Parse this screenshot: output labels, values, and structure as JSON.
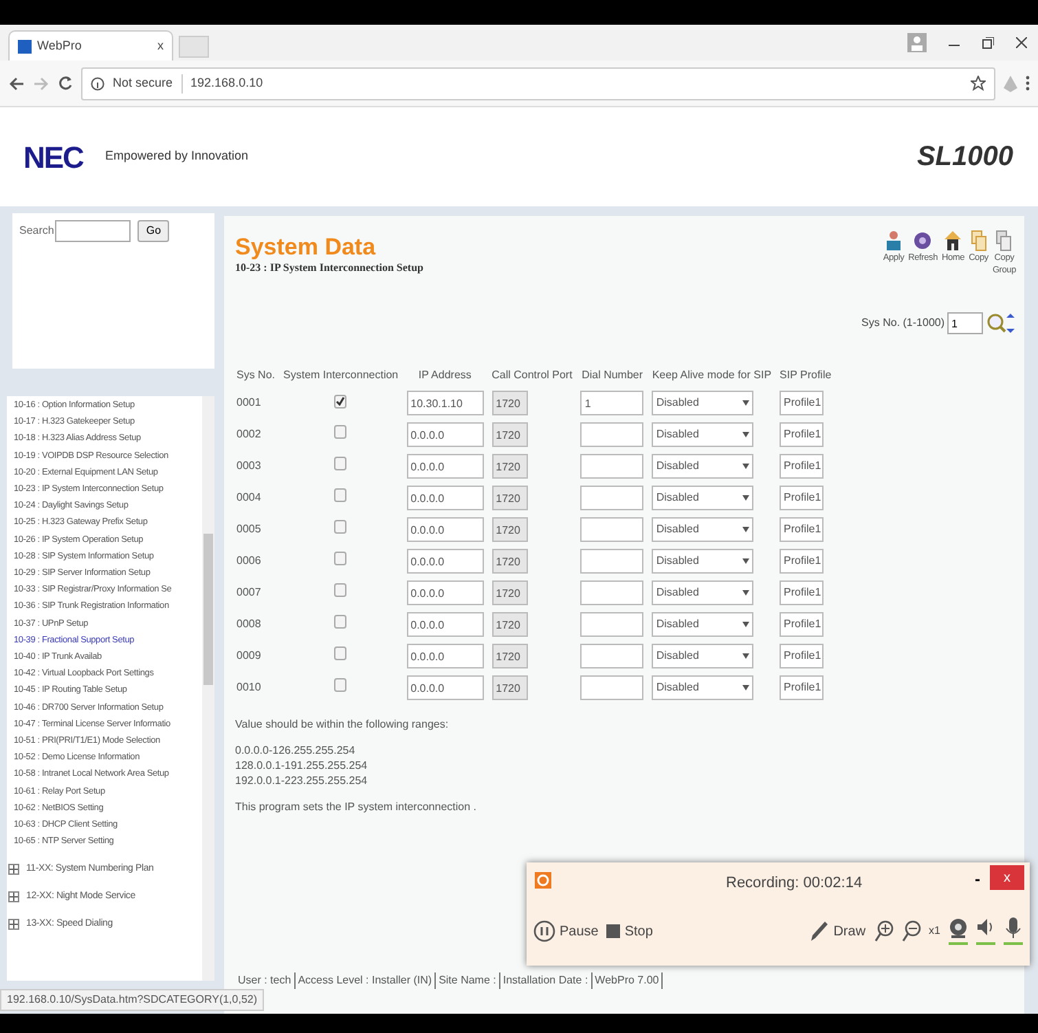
{
  "browser": {
    "tab_title": "WebPro",
    "tab_close": "x",
    "security": "Not secure",
    "url": "192.168.0.10"
  },
  "header": {
    "logo": "NEC",
    "tagline": "Empowered by Innovation",
    "model": "SL1000"
  },
  "search": {
    "label": "Search",
    "button": "Go"
  },
  "tree": {
    "items": [
      {
        "label": "10-16 : Option Information Setup",
        "selected": false
      },
      {
        "label": "10-17 : H.323 Gatekeeper Setup",
        "selected": false
      },
      {
        "label": "10-18 : H.323 Alias Address Setup",
        "selected": false
      },
      {
        "label": "10-19 : VOIPDB DSP Resource Selection",
        "selected": false
      },
      {
        "label": "10-20 : External Equipment LAN Setup",
        "selected": false
      },
      {
        "label": "10-23 : IP System Interconnection Setup",
        "selected": false
      },
      {
        "label": "10-24 : Daylight Savings Setup",
        "selected": false
      },
      {
        "label": "10-25 : H.323 Gateway Prefix Setup",
        "selected": false
      },
      {
        "label": "10-26 : IP System Operation Setup",
        "selected": false
      },
      {
        "label": "10-28 : SIP System Information Setup",
        "selected": false
      },
      {
        "label": "10-29 : SIP Server Information Setup",
        "selected": false
      },
      {
        "label": "10-33 : SIP Registrar/Proxy Information Se",
        "selected": false
      },
      {
        "label": "10-36 : SIP Trunk Registration Information",
        "selected": false
      },
      {
        "label": "10-37 : UPnP Setup",
        "selected": false
      },
      {
        "label": "10-39 : Fractional Support Setup",
        "selected": true
      },
      {
        "label": "10-40 : IP Trunk Availab",
        "selected": false
      },
      {
        "label": "10-42 : Virtual Loopback Port Settings",
        "selected": false
      },
      {
        "label": "10-45 : IP Routing Table Setup",
        "selected": false
      },
      {
        "label": "10-46 : DR700 Server Information Setup",
        "selected": false
      },
      {
        "label": "10-47 : Terminal License Server Informatio",
        "selected": false
      },
      {
        "label": "10-51 : PRI(PRI/T1/E1) Mode Selection",
        "selected": false
      },
      {
        "label": "10-52 : Demo License Information",
        "selected": false
      },
      {
        "label": "10-58 : Intranet Local Network Area Setup",
        "selected": false
      },
      {
        "label": "10-61 : Relay Port Setup",
        "selected": false
      },
      {
        "label": "10-62 : NetBIOS Setting",
        "selected": false
      },
      {
        "label": "10-63 : DHCP Client Setting",
        "selected": false
      },
      {
        "label": "10-65 : NTP Server Setting",
        "selected": false
      }
    ],
    "groups": [
      {
        "label": "11-XX: System Numbering Plan",
        "expanded": false
      },
      {
        "label": "12-XX: Night Mode Service",
        "expanded": false
      },
      {
        "label": "13-XX: Speed Dialing",
        "expanded": false
      }
    ]
  },
  "page": {
    "title": "System Data",
    "subtitle": "10-23 : IP System Interconnection Setup",
    "toolbar": [
      {
        "kind": "apply",
        "label": "Apply"
      },
      {
        "kind": "refresh",
        "label": "Refresh"
      },
      {
        "kind": "home",
        "label": "Home"
      },
      {
        "kind": "copy",
        "label": "Copy"
      },
      {
        "kind": "copygroup",
        "label": "Copy Group"
      }
    ],
    "sysno_label": "Sys No. (1-1000)",
    "sysno_value": "1"
  },
  "table": {
    "columns": [
      "Sys No.",
      "System Interconnection",
      "IP Address",
      "Call Control Port",
      "Dial Number",
      "Keep Alive mode for SIP",
      "SIP Profile"
    ],
    "rows": [
      {
        "sys_no": "0001",
        "checked": true,
        "ip": "10.30.1.10",
        "port": "1720",
        "dial": "1",
        "keep_alive": "Disabled",
        "profile": "Profile1"
      },
      {
        "sys_no": "0002",
        "checked": false,
        "ip": "0.0.0.0",
        "port": "1720",
        "dial": "",
        "keep_alive": "Disabled",
        "profile": "Profile1"
      },
      {
        "sys_no": "0003",
        "checked": false,
        "ip": "0.0.0.0",
        "port": "1720",
        "dial": "",
        "keep_alive": "Disabled",
        "profile": "Profile1"
      },
      {
        "sys_no": "0004",
        "checked": false,
        "ip": "0.0.0.0",
        "port": "1720",
        "dial": "",
        "keep_alive": "Disabled",
        "profile": "Profile1"
      },
      {
        "sys_no": "0005",
        "checked": false,
        "ip": "0.0.0.0",
        "port": "1720",
        "dial": "",
        "keep_alive": "Disabled",
        "profile": "Profile1"
      },
      {
        "sys_no": "0006",
        "checked": false,
        "ip": "0.0.0.0",
        "port": "1720",
        "dial": "",
        "keep_alive": "Disabled",
        "profile": "Profile1"
      },
      {
        "sys_no": "0007",
        "checked": false,
        "ip": "0.0.0.0",
        "port": "1720",
        "dial": "",
        "keep_alive": "Disabled",
        "profile": "Profile1"
      },
      {
        "sys_no": "0008",
        "checked": false,
        "ip": "0.0.0.0",
        "port": "1720",
        "dial": "",
        "keep_alive": "Disabled",
        "profile": "Profile1"
      },
      {
        "sys_no": "0009",
        "checked": false,
        "ip": "0.0.0.0",
        "port": "1720",
        "dial": "",
        "keep_alive": "Disabled",
        "profile": "Profile1"
      },
      {
        "sys_no": "0010",
        "checked": false,
        "ip": "0.0.0.0",
        "port": "1720",
        "dial": "",
        "keep_alive": "Disabled",
        "profile": "Profile1"
      }
    ]
  },
  "notes": {
    "heading": "Value should be within the following ranges:",
    "ranges": [
      "0.0.0.0-126.255.255.254",
      "128.0.0.1-191.255.255.254",
      "192.0.0.1-223.255.255.254"
    ],
    "description": "This program sets the IP system interconnection ."
  },
  "footer": [
    "User : tech",
    "Access Level : Installer (IN)",
    "Site Name :",
    "Installation Date :",
    "WebPro 7.00"
  ],
  "recorder": {
    "title": "Recording: 00:02:14",
    "close": "x",
    "minimize": "-",
    "pause": "Pause",
    "stop": "Stop",
    "draw": "Draw",
    "zoom": "x1"
  },
  "status_url": "192.168.0.10/SysData.htm?SDCATEGORY(1,0,52)"
}
